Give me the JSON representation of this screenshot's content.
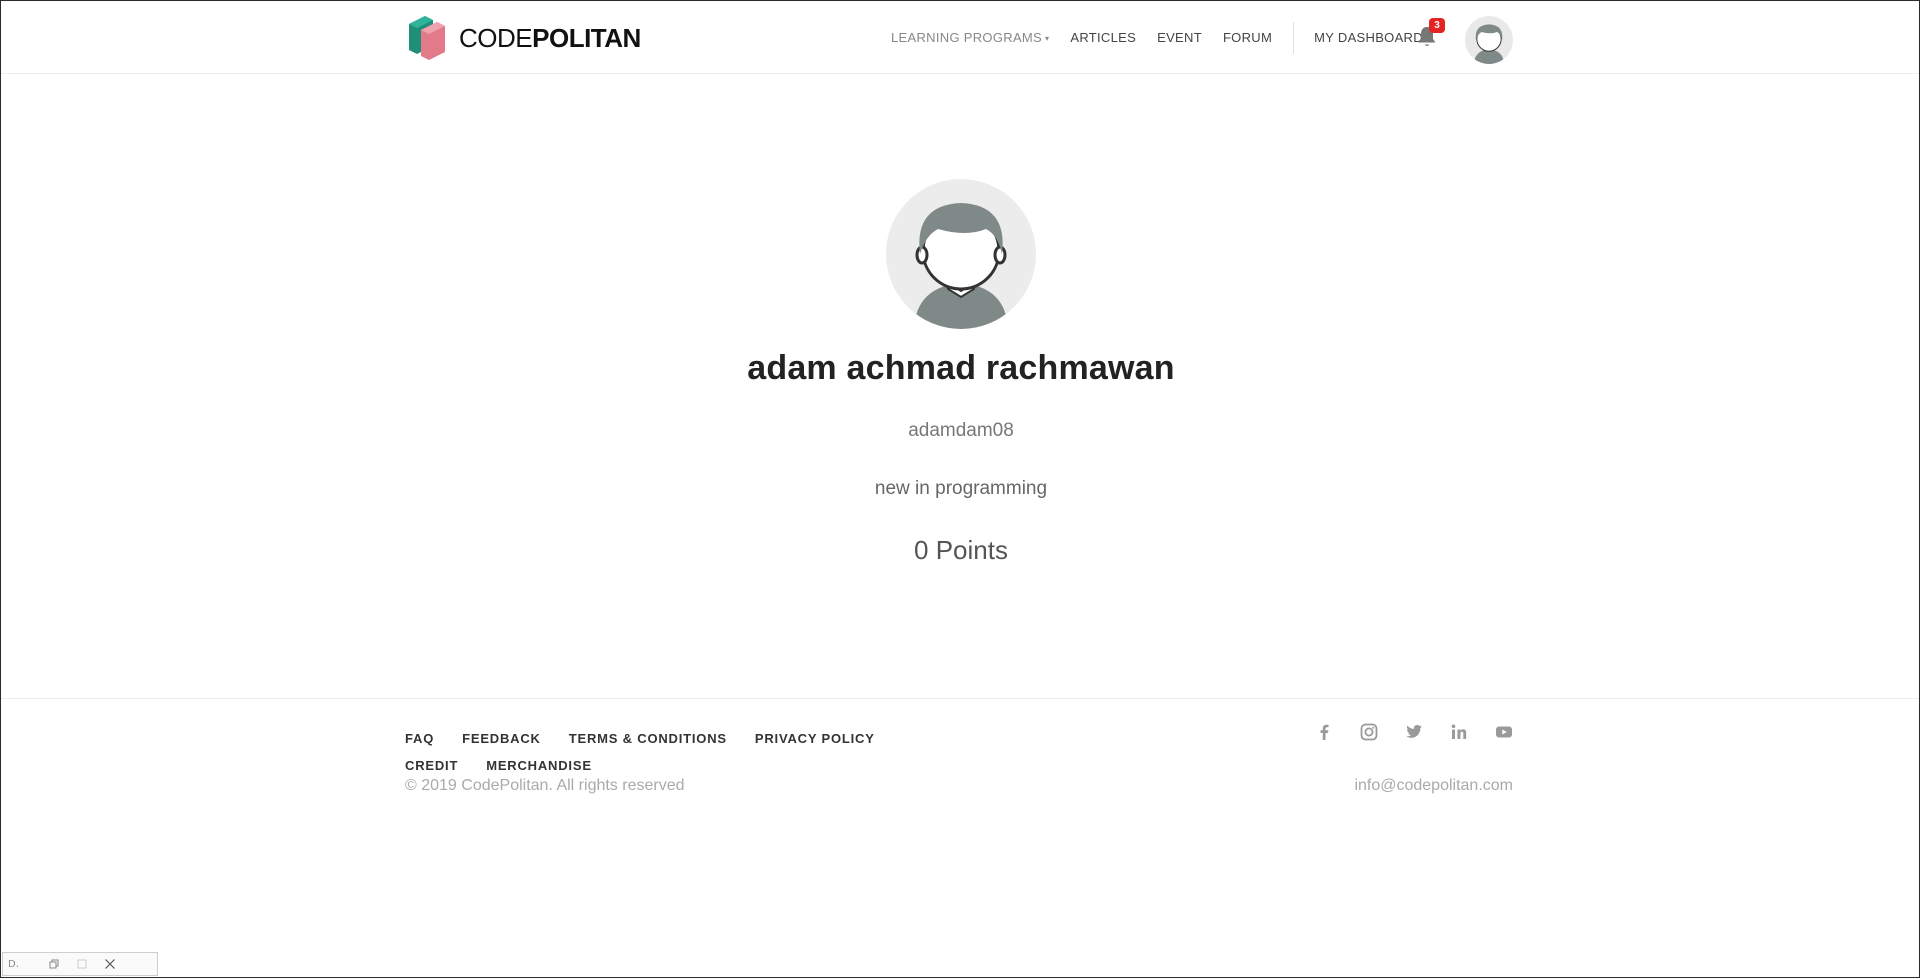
{
  "brand": {
    "name_light": "CODE",
    "name_bold": "POLITAN",
    "colors": {
      "green": "#1f8f7a",
      "pink": "#e27a8a"
    }
  },
  "nav": {
    "items": [
      {
        "label": "LEARNING PROGRAMS",
        "has_dropdown": true
      },
      {
        "label": "ARTICLES"
      },
      {
        "label": "EVENT"
      },
      {
        "label": "FORUM"
      }
    ],
    "dashboard": "MY DASHBOARD",
    "notifications_count": "3",
    "icons": {
      "bell": "bell-icon",
      "avatar": "user-avatar"
    }
  },
  "profile": {
    "name": "adam achmad rachmawan",
    "username": "adamdam08",
    "bio": "new in programming",
    "points": "0 Points"
  },
  "footer": {
    "links": [
      "FAQ",
      "FEEDBACK",
      "TERMS & CONDITIONS",
      "PRIVACY POLICY",
      "CREDIT",
      "MERCHANDISE"
    ],
    "copyright": "© 2019 CodePolitan. All rights reserved",
    "email": "info@codepolitan.com",
    "socials": [
      "facebook-icon",
      "instagram-icon",
      "twitter-icon",
      "linkedin-icon",
      "youtube-icon"
    ]
  },
  "mini_window": {
    "title": "D."
  },
  "colors": {
    "badge": "#e52323",
    "avatar_bg": "#ececec",
    "avatar_figure": "#7f8a88",
    "muted_text": "#aaaaaa"
  }
}
